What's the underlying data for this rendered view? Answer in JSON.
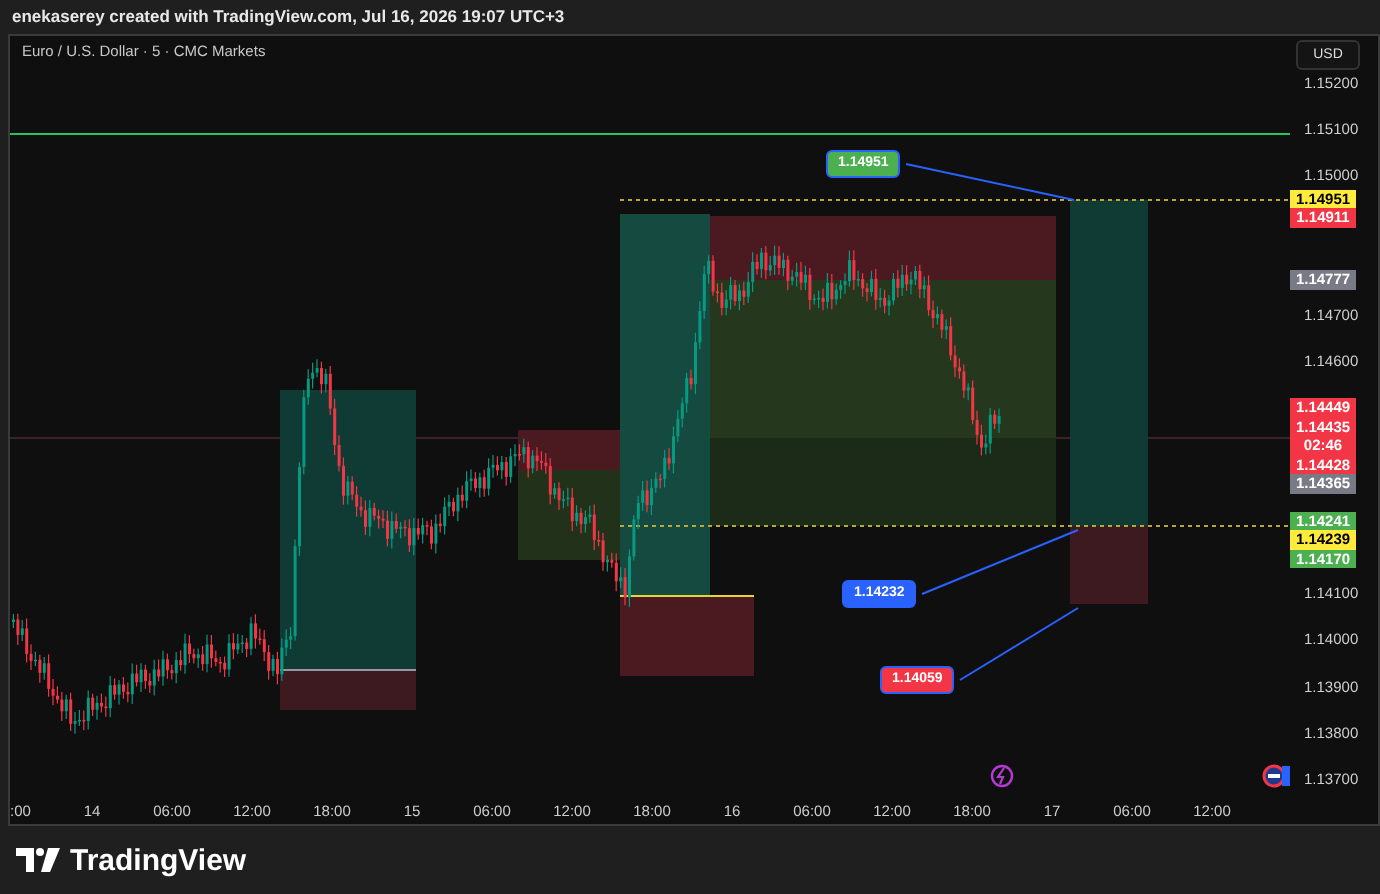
{
  "header": {
    "text": "enekaserey created with TradingView.com, Jul 16, 2026 19:07 UTC+3"
  },
  "chart": {
    "title": "Euro / U.S. Dollar · 5 · CMC Markets",
    "callouts": [
      {
        "text": "1.14951",
        "color": "#4caf50"
      },
      {
        "text": "1.14232",
        "color": "#2962ff"
      },
      {
        "text": "1.14059",
        "color": "#f23645"
      }
    ]
  },
  "price_axis": {
    "currency": "USD",
    "ticks": [
      "1.15200",
      "1.15100",
      "1.15000",
      "1.14700",
      "1.14600",
      "1.14100",
      "1.14000",
      "1.13900",
      "1.13800",
      "1.13700"
    ],
    "tag_groups": [
      [
        {
          "text": "1.14951",
          "color": "#ffeb3b"
        },
        {
          "text": "1.14911",
          "color": "#f23645"
        }
      ],
      [
        {
          "text": "1.14777",
          "color": "#787b86"
        }
      ],
      [
        {
          "text": "1.14449",
          "color": "#f23645"
        },
        {
          "text": "1.14435",
          "countdown": "02:46",
          "color": "#f23645"
        },
        {
          "text": "1.14428",
          "color": "#f23645"
        },
        {
          "text": "1.14365",
          "color": "#787b86"
        }
      ],
      [
        {
          "text": "1.14241",
          "color": "#4caf50"
        },
        {
          "text": "1.14239",
          "color": "#ffeb3b"
        },
        {
          "text": "1.14170",
          "color": "#4caf50"
        }
      ]
    ]
  },
  "time_axis": [
    ":00",
    "14",
    "06:00",
    "12:00",
    "18:00",
    "15",
    "06:00",
    "12:00",
    "18:00",
    "16",
    "06:00",
    "12:00",
    "18:00",
    "17",
    "06:00",
    "12:00"
  ],
  "footer": {
    "brand": "TradingView"
  }
}
